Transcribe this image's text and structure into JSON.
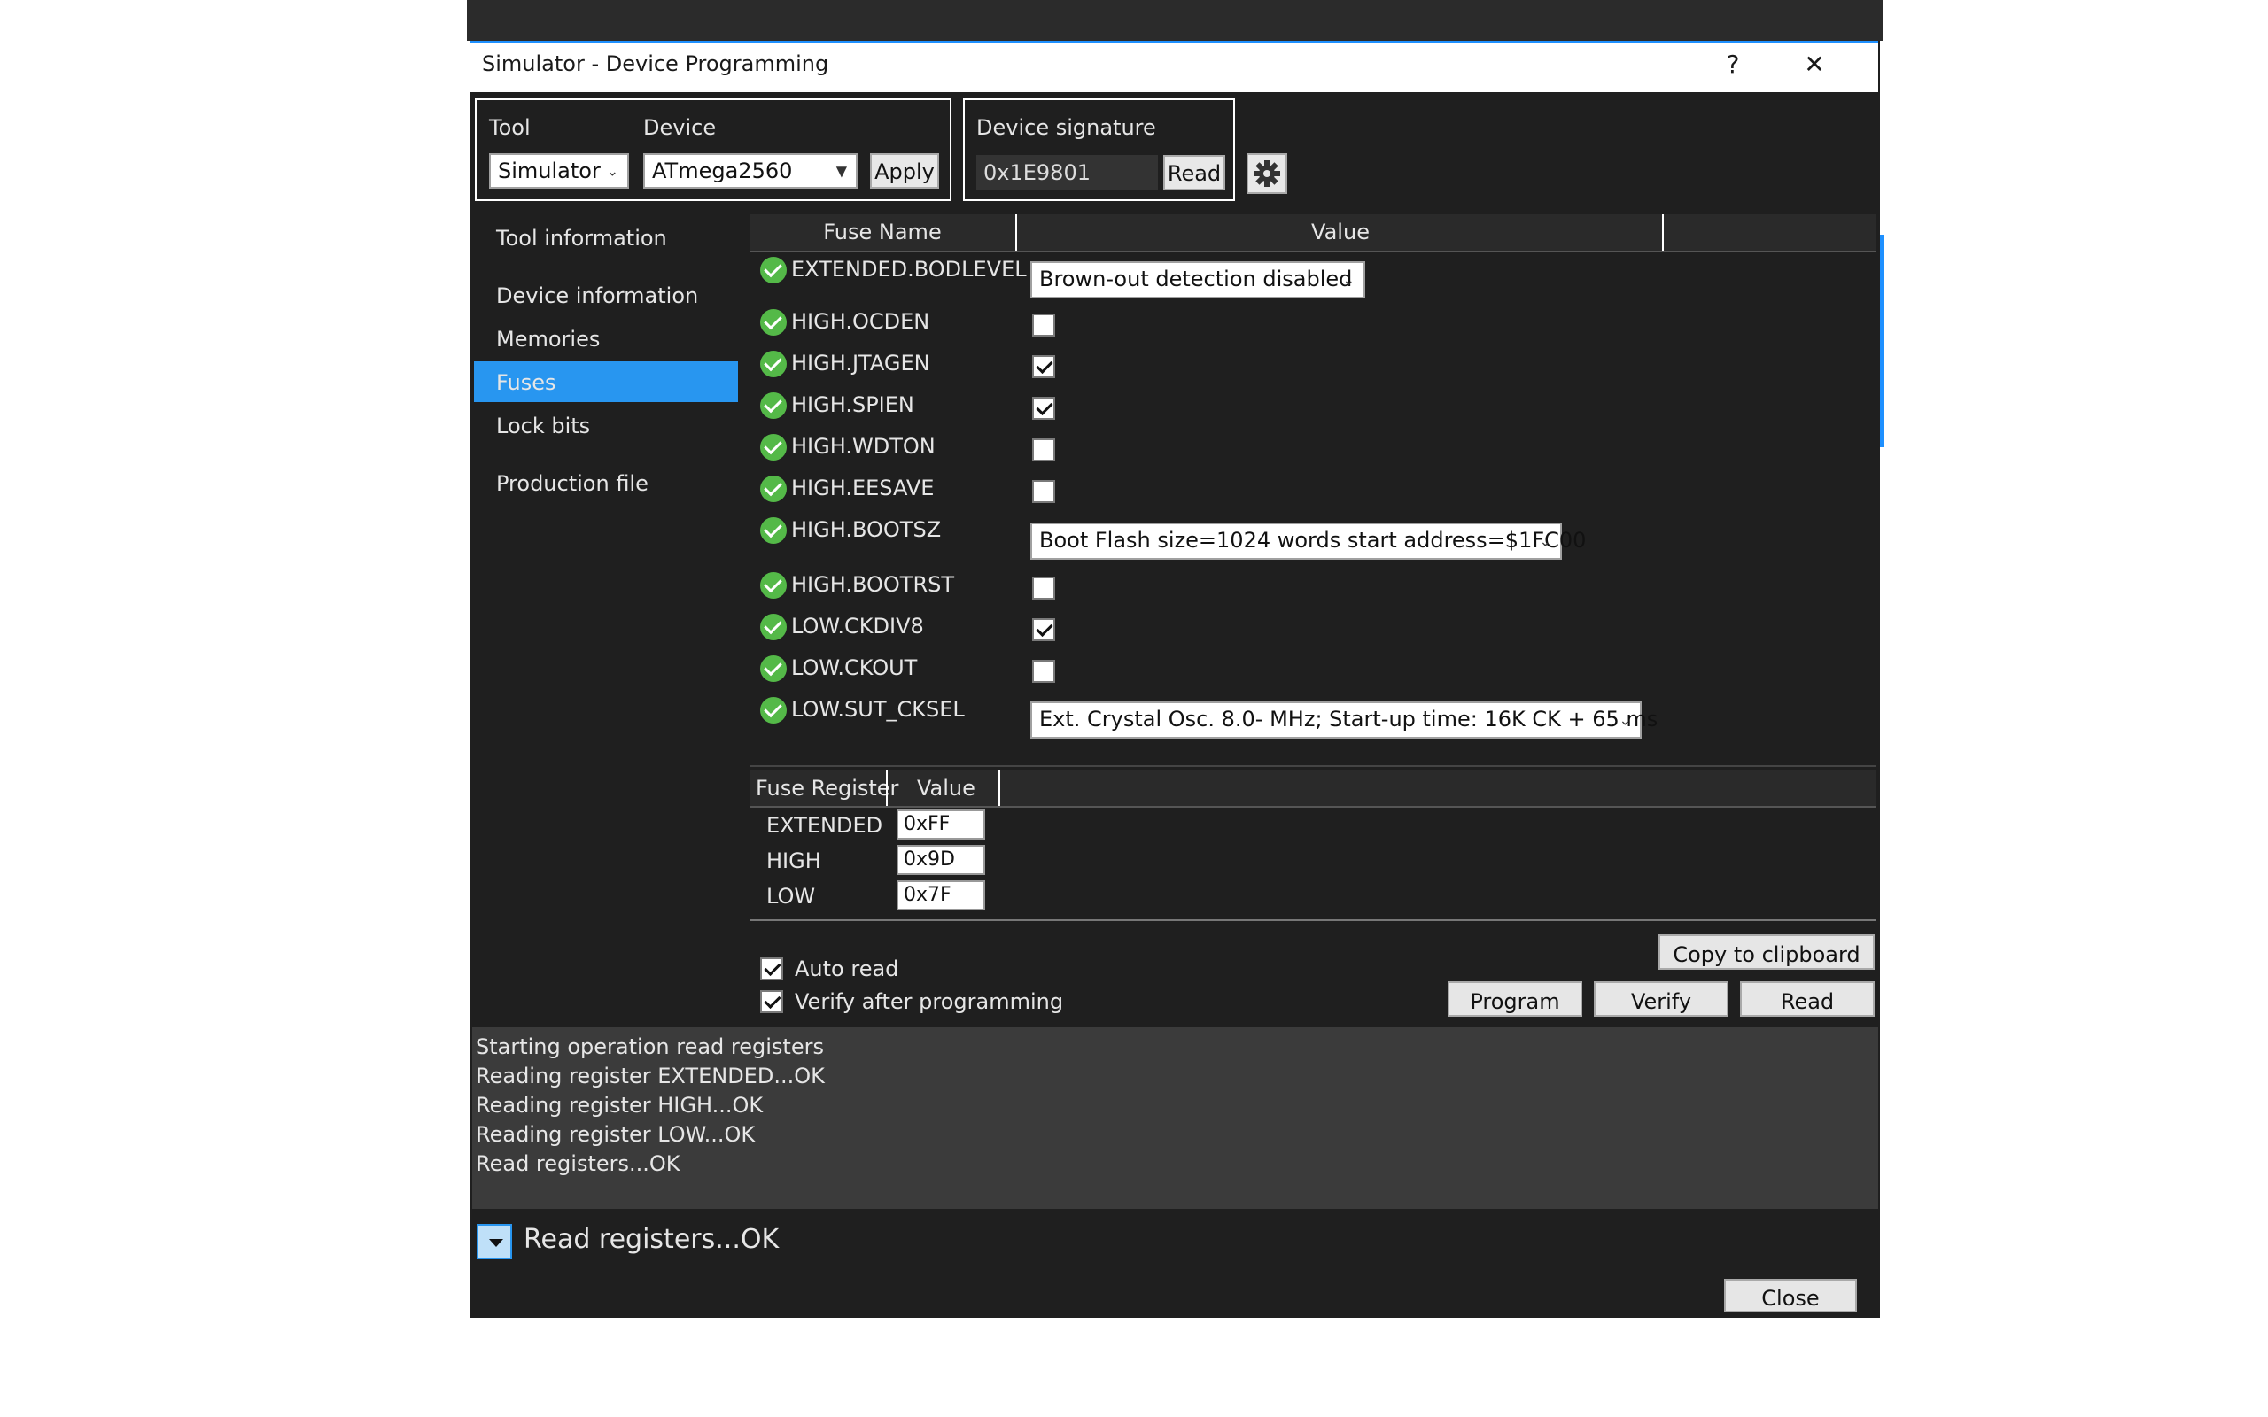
{
  "window": {
    "title": "Simulator - Device Programming",
    "help_label": "?",
    "close_label": "✕"
  },
  "tool": {
    "label": "Tool",
    "value": "Simulator"
  },
  "device": {
    "label": "Device",
    "value": "ATmega2560",
    "apply_label": "Apply"
  },
  "signature": {
    "label": "Device signature",
    "value": "0x1E9801",
    "read_label": "Read"
  },
  "settings_icon": "gear-icon",
  "sidebar": {
    "items": [
      {
        "label": "Tool information"
      },
      {
        "label": "Device information"
      },
      {
        "label": "Memories"
      },
      {
        "label": "Fuses",
        "selected": true
      },
      {
        "label": "Lock bits"
      },
      {
        "label": "Production file"
      }
    ]
  },
  "fuses_table": {
    "headers": {
      "name": "Fuse Name",
      "value": "Value"
    },
    "rows": [
      {
        "name": "EXTENDED.BODLEVEL",
        "type": "select",
        "value": "Brown-out detection disabled"
      },
      {
        "name": "HIGH.OCDEN",
        "type": "checkbox",
        "checked": false
      },
      {
        "name": "HIGH.JTAGEN",
        "type": "checkbox",
        "checked": true
      },
      {
        "name": "HIGH.SPIEN",
        "type": "checkbox",
        "checked": true
      },
      {
        "name": "HIGH.WDTON",
        "type": "checkbox",
        "checked": false
      },
      {
        "name": "HIGH.EESAVE",
        "type": "checkbox",
        "checked": false
      },
      {
        "name": "HIGH.BOOTSZ",
        "type": "select",
        "value": "Boot Flash size=1024 words start address=$1FC00"
      },
      {
        "name": "HIGH.BOOTRST",
        "type": "checkbox",
        "checked": false
      },
      {
        "name": "LOW.CKDIV8",
        "type": "checkbox",
        "checked": true
      },
      {
        "name": "LOW.CKOUT",
        "type": "checkbox",
        "checked": false
      },
      {
        "name": "LOW.SUT_CKSEL",
        "type": "select",
        "value": "Ext. Crystal Osc. 8.0-    MHz; Start-up time: 16K CK + 65 ms"
      }
    ]
  },
  "register_table": {
    "headers": {
      "name": "Fuse Register",
      "value": "Value"
    },
    "rows": [
      {
        "name": "EXTENDED",
        "value": "0xFF"
      },
      {
        "name": "HIGH",
        "value": "0x9D"
      },
      {
        "name": "LOW",
        "value": "0x7F"
      }
    ]
  },
  "options": {
    "auto_read": {
      "label": "Auto read",
      "checked": true
    },
    "verify_after": {
      "label": "Verify after programming",
      "checked": true
    }
  },
  "actions": {
    "copy_label": "Copy to clipboard",
    "program_label": "Program",
    "verify_label": "Verify",
    "read_label": "Read"
  },
  "log": {
    "lines": [
      "Starting operation read registers",
      "Reading register EXTENDED...OK",
      "Reading register HIGH...OK",
      "Reading register LOW...OK",
      "Read registers...OK"
    ]
  },
  "status": {
    "text": "Read registers...OK"
  },
  "footer": {
    "close_label": "Close"
  },
  "colors": {
    "accent": "#2896f0",
    "ok": "#54b948",
    "window_bg": "#1f1f1f",
    "log_bg": "#3b3b3b"
  }
}
